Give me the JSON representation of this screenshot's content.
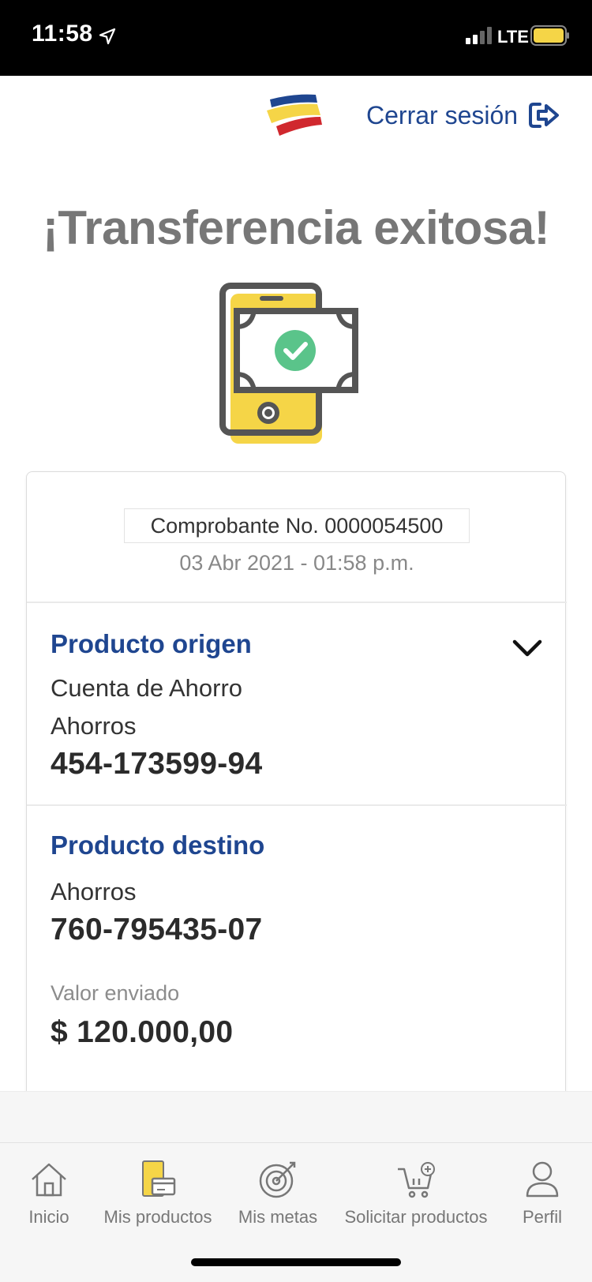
{
  "status_bar": {
    "time": "11:58",
    "network": "LTE",
    "battery_color": "#f5d547"
  },
  "header": {
    "logout_label": "Cerrar sesión",
    "brand_colors": [
      "#1f4690",
      "#f5d547",
      "#d0282e"
    ]
  },
  "title": "¡Transferencia exitosa!",
  "receipt": {
    "number_label": "Comprobante No. 0000054500",
    "date": "03 Abr 2021 - 01:58 p.m."
  },
  "origin": {
    "title": "Producto origen",
    "product_name": "Cuenta de Ahorro",
    "account_type": "Ahorros",
    "account_number": "454-173599-94"
  },
  "destination": {
    "title": "Producto destino",
    "account_type": "Ahorros",
    "account_number": "760-795435-07",
    "amount_label": "Valor enviado",
    "amount": "$ 120.000,00"
  },
  "nav": {
    "items": [
      {
        "label": "Inicio",
        "icon": "home-icon"
      },
      {
        "label": "Mis productos",
        "icon": "products-icon"
      },
      {
        "label": "Mis metas",
        "icon": "target-icon"
      },
      {
        "label": "Solicitar productos",
        "icon": "cart-icon"
      },
      {
        "label": "Perfil",
        "icon": "user-icon"
      }
    ]
  },
  "colors": {
    "primary": "#1f4690",
    "accent_yellow": "#f5d547",
    "success_green": "#5ac48a",
    "title_gray": "#777777"
  }
}
